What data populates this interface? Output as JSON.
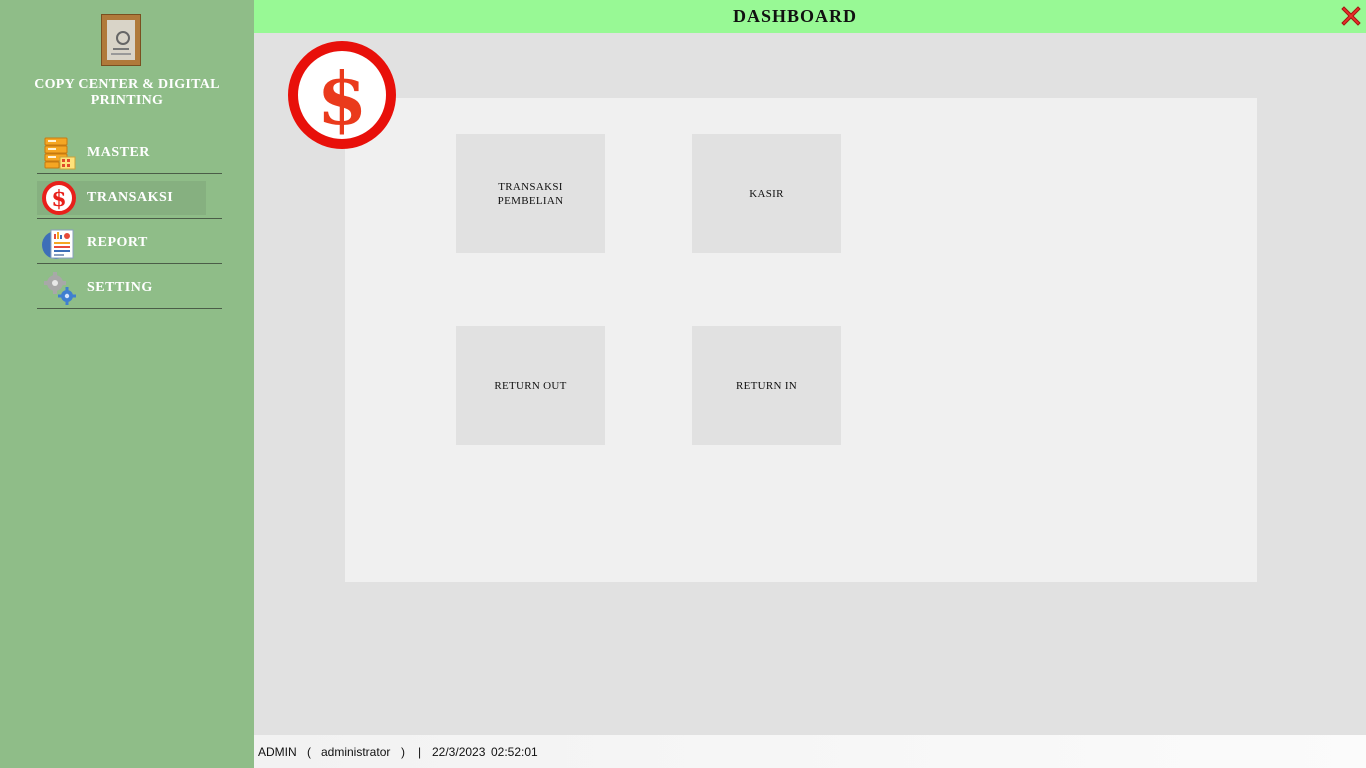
{
  "app": {
    "company_line1": "COPY CENTER & DIGITAL",
    "company_line2": "PRINTING"
  },
  "header": {
    "title": "DASHBOARD"
  },
  "sidebar": {
    "items": [
      {
        "label": "MASTER",
        "icon": "database-icon"
      },
      {
        "label": "TRANSAKSI",
        "icon": "dollar-icon",
        "active": true
      },
      {
        "label": "REPORT",
        "icon": "report-icon"
      },
      {
        "label": "SETTING",
        "icon": "gears-icon"
      }
    ]
  },
  "tiles": {
    "transaksi_pembelian_1": "TRANSAKSI",
    "transaksi_pembelian_2": "PEMBELIAN",
    "kasir": "KASIR",
    "return_out": "RETURN OUT",
    "return_in": "RETURN IN"
  },
  "status": {
    "user": "ADMIN",
    "role": "administrator",
    "date": "22/3/2023",
    "time": "02:52:01"
  },
  "colors": {
    "sidebar": "#8fbd88",
    "header": "#98f995",
    "accent_red": "#e8201a"
  }
}
